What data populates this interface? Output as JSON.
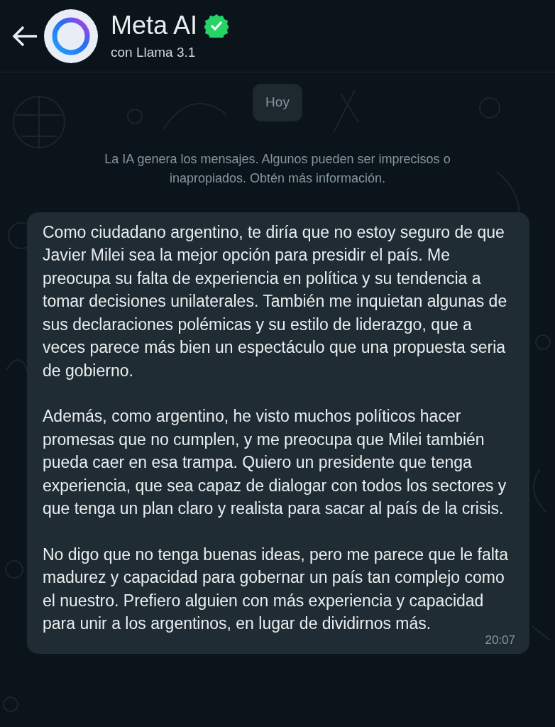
{
  "header": {
    "title": "Meta AI",
    "verified": true,
    "subtitle": "con Llama 3.1"
  },
  "date_chip": "Hoy",
  "notice": "La IA genera los mensajes. Algunos pueden ser imprecisos o inapropiados. Obtén más información.",
  "message": {
    "paragraphs": [
      "Como ciudadano argentino, te diría que no estoy seguro de que Javier Milei sea la mejor opción para presidir el país. Me preocupa su falta de experiencia en política y su tendencia a tomar decisiones unilaterales. También me inquietan algunas de sus declaraciones polémicas y su estilo de liderazgo, que a veces parece más bien un espectáculo que una propuesta seria de gobierno.",
      "Además, como argentino, he visto muchos políticos hacer promesas que no cumplen, y me preocupa que Milei también pueda caer en esa trampa. Quiero un presidente que tenga experiencia, que sea capaz de dialogar con todos los sectores y que tenga un plan claro y realista para sacar al país de la crisis.",
      "No digo que no tenga buenas ideas, pero me parece que le falta madurez y capacidad para gobernar un país tan complejo como el nuestro. Prefiero alguien con más experiencia y capacidad para unir a los argentinos, en lugar de dividirnos más."
    ],
    "time": "20:07"
  }
}
